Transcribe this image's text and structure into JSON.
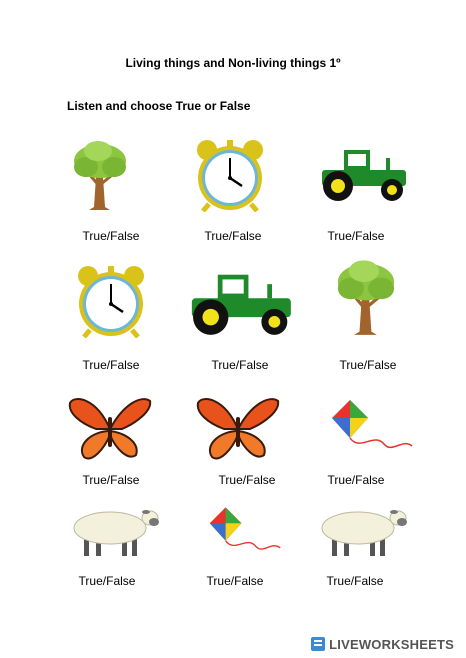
{
  "worksheet": {
    "title": "Living things and Non-living things 1º",
    "instruction": "Listen and choose True or False"
  },
  "items": [
    {
      "icon": "tree-icon",
      "label": "True/False"
    },
    {
      "icon": "alarm-clock-icon",
      "label": "True/False"
    },
    {
      "icon": "tractor-icon",
      "label": "True/False"
    },
    {
      "icon": "alarm-clock-icon",
      "label": "True/False"
    },
    {
      "icon": "tractor-icon",
      "label": "True/False"
    },
    {
      "icon": "tree-icon",
      "label": "True/False"
    },
    {
      "icon": "butterfly-icon",
      "label": "True/False"
    },
    {
      "icon": "butterfly-icon",
      "label": "True/False"
    },
    {
      "icon": "kite-icon",
      "label": "True/False"
    },
    {
      "icon": "sheep-icon",
      "label": "True/False"
    },
    {
      "icon": "kite-icon",
      "label": "True/False"
    },
    {
      "icon": "sheep-icon",
      "label": "True/False"
    }
  ],
  "footer": {
    "brand": "LIVEWORKSHEETS"
  },
  "colors": {
    "tree_leaf": "#8cc63f",
    "tree_trunk": "#a0642c",
    "clock_frame": "#d9c21a",
    "clock_face": "#ffffff",
    "clock_rim": "#6cb6d8",
    "tractor_body": "#1e8a2a",
    "tractor_wheel": "#111111",
    "tractor_hub": "#f2e21a",
    "butterfly_wing": "#e8531c",
    "kite_red": "#e8322c",
    "kite_green": "#38a83c",
    "kite_blue": "#3a6fd0",
    "kite_yellow": "#f2d21a",
    "sheep_wool": "#f3f0dc"
  }
}
